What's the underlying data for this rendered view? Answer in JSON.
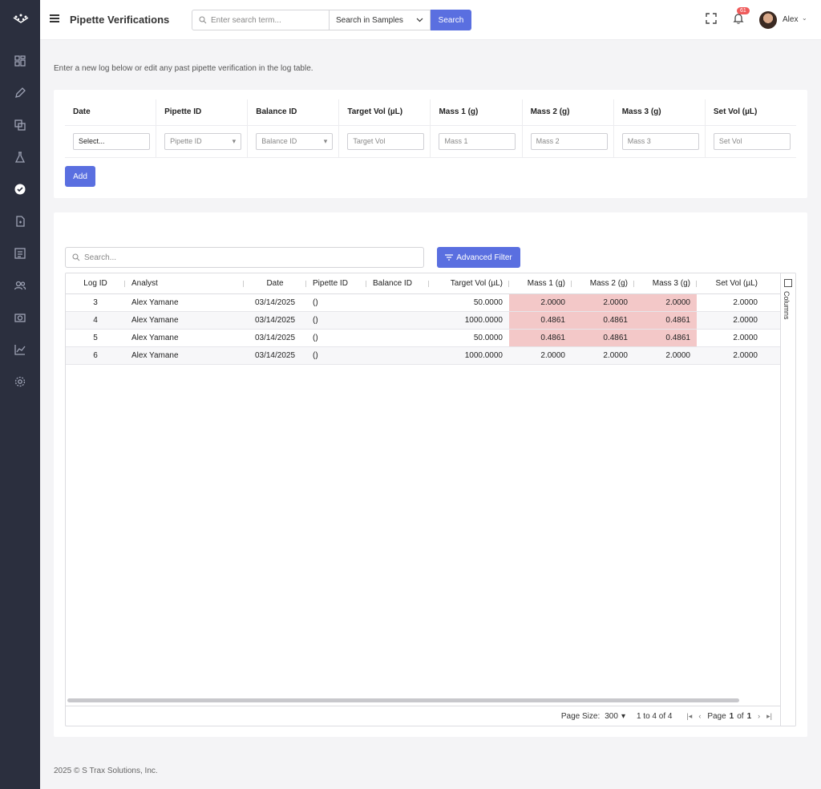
{
  "app": {
    "title": "Pipette Verifications"
  },
  "topbar": {
    "search_placeholder": "Enter search term...",
    "search_scope": "Search in Samples",
    "search_button": "Search",
    "notifications_count": "61",
    "user_name": "Alex"
  },
  "sidebar": {
    "items": [
      "dashboard-icon",
      "pencil-icon",
      "copy-icon",
      "flask-icon",
      "verified-icon",
      "report-icon",
      "list-icon",
      "users-icon",
      "camera-icon",
      "chart-icon",
      "settings-icon"
    ],
    "active_index": 4
  },
  "intro": "Enter a new log below or edit any past pipette verification in the log table.",
  "entry_form": {
    "headers": [
      "Date",
      "Pipette ID",
      "Balance ID",
      "Target Vol (µL)",
      "Mass 1 (g)",
      "Mass 2 (g)",
      "Mass 3 (g)",
      "Set Vol (µL)"
    ],
    "fields": {
      "date": "Select...",
      "pipette_id": "Pipette ID",
      "balance_id": "Balance ID",
      "target_vol": "Target Vol",
      "mass1": "Mass 1",
      "mass2": "Mass 2",
      "mass3": "Mass 3",
      "set_vol": "Set Vol"
    },
    "add_button": "Add"
  },
  "log_table": {
    "search_placeholder": "Search...",
    "advanced_filter_button": "Advanced Filter",
    "columns": [
      "Log ID",
      "Analyst",
      "Date",
      "Pipette ID",
      "Balance ID",
      "Target Vol (µL)",
      "Mass 1 (g)",
      "Mass 2 (g)",
      "Mass 3 (g)",
      "Set Vol (µL)"
    ],
    "rows": [
      {
        "log_id": "3",
        "analyst": "Alex Yamane",
        "date": "03/14/2025",
        "pipette_id": "()",
        "balance_id": "",
        "target_vol": "50.0000",
        "mass1": "2.0000",
        "mass2": "2.0000",
        "mass3": "2.0000",
        "set_vol": "2.0000",
        "flagged": true
      },
      {
        "log_id": "4",
        "analyst": "Alex Yamane",
        "date": "03/14/2025",
        "pipette_id": "()",
        "balance_id": "",
        "target_vol": "1000.0000",
        "mass1": "0.4861",
        "mass2": "0.4861",
        "mass3": "0.4861",
        "set_vol": "2.0000",
        "flagged": true
      },
      {
        "log_id": "5",
        "analyst": "Alex Yamane",
        "date": "03/14/2025",
        "pipette_id": "()",
        "balance_id": "",
        "target_vol": "50.0000",
        "mass1": "0.4861",
        "mass2": "0.4861",
        "mass3": "0.4861",
        "set_vol": "2.0000",
        "flagged": true
      },
      {
        "log_id": "6",
        "analyst": "Alex Yamane",
        "date": "03/14/2025",
        "pipette_id": "()",
        "balance_id": "",
        "target_vol": "1000.0000",
        "mass1": "2.0000",
        "mass2": "2.0000",
        "mass3": "2.0000",
        "set_vol": "2.0000",
        "flagged": false
      }
    ],
    "side_panel_label": "Columns",
    "pagination": {
      "page_size_label": "Page Size:",
      "page_size": "300",
      "range": "1 to 4 of 4",
      "page_label": "Page",
      "page_current": "1",
      "of_label": "of",
      "page_total": "1"
    }
  },
  "footer": "2025 © S Trax Solutions, Inc.",
  "colors": {
    "accent": "#5a6fe0",
    "sidebar": "#2b2f3e",
    "flag": "#f3c8c8"
  }
}
